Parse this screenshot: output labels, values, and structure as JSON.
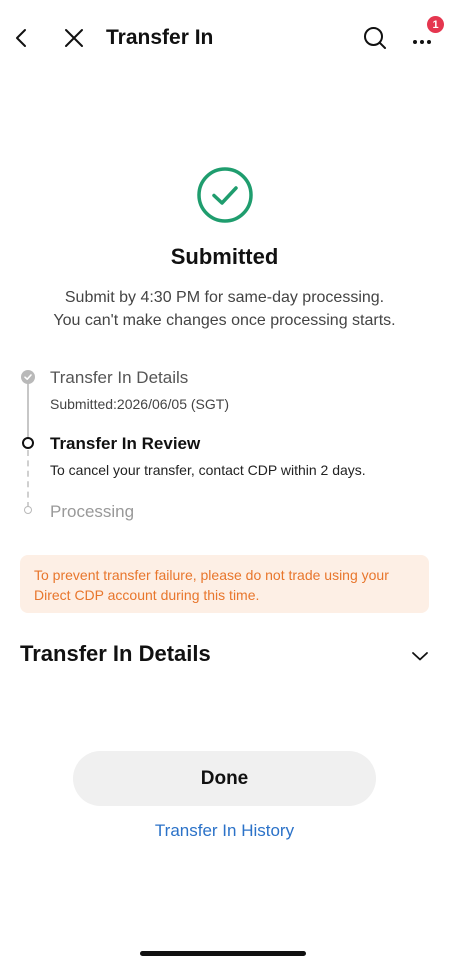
{
  "header": {
    "title": "Transfer In",
    "notification_count": "1",
    "icons": [
      "back-icon",
      "close-icon",
      "search-icon",
      "more-icon"
    ]
  },
  "status": {
    "icon": "check-circle-icon",
    "title": "Submitted",
    "description_line1": "Submit by 4:30 PM for same-day processing.",
    "description_line2": "You can't make changes once processing starts."
  },
  "timeline": {
    "steps": [
      {
        "title": "Transfer In Details",
        "subtitle": "Submitted:2026/06/05 (SGT)",
        "state": "done"
      },
      {
        "title": "Transfer In Review",
        "subtitle": "To cancel your transfer, contact CDP within 2 days.",
        "state": "active"
      },
      {
        "title": "Processing",
        "subtitle": "",
        "state": "pending"
      }
    ]
  },
  "warning": {
    "text": "To prevent transfer failure, please do not trade using your Direct CDP account during this time."
  },
  "details_section": {
    "title": "Transfer In Details"
  },
  "actions": {
    "done_label": "Done",
    "history_link": "Transfer In History"
  },
  "colors": {
    "success": "#1f9d6e",
    "warning_text": "#e8762c",
    "warning_bg": "#fdefe5",
    "link": "#2b72c8",
    "badge": "#e5364f"
  }
}
